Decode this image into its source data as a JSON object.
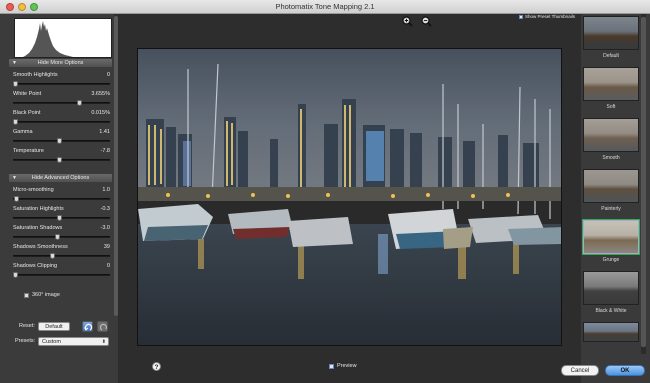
{
  "window": {
    "title": "Photomatix Tone Mapping 2.1"
  },
  "more_options": {
    "header": "Hide More Options",
    "sliders": [
      {
        "label": "Smooth Highlights",
        "value": "0",
        "level": 0.02
      },
      {
        "label": "White Point",
        "value": "3.655%",
        "level": 0.68
      },
      {
        "label": "Black Point",
        "value": "0.015%",
        "level": 0.02
      },
      {
        "label": "Gamma",
        "value": "1.41",
        "level": 0.47
      },
      {
        "label": "Temperature",
        "value": "-7.8",
        "level": 0.47
      }
    ]
  },
  "advanced_options": {
    "header": "Hide Advanced Options",
    "sliders": [
      {
        "label": "Micro-smoothing",
        "value": "1.0",
        "level": 0.03
      },
      {
        "label": "Saturation Highlights",
        "value": "-0.3",
        "level": 0.47
      },
      {
        "label": "Saturation Shadows",
        "value": "-3.0",
        "level": 0.45
      },
      {
        "label": "Shadows Smoothness",
        "value": "39",
        "level": 0.4
      },
      {
        "label": "Shadows Clipping",
        "value": "0",
        "level": 0.02
      }
    ],
    "image_360_label": "360° image"
  },
  "bottom": {
    "reset_label": "Reset:",
    "default_button": "Default",
    "presets_label": "Presets:",
    "presets_value": "Custom"
  },
  "main": {
    "preview_label": "Preview",
    "help_label": "?"
  },
  "preset_panel": {
    "show_thumbnails_label": "Show Preset Thumbnails",
    "presets": [
      "Default",
      "Soft",
      "Smooth",
      "Painterly",
      "Grunge",
      "Black & White",
      ""
    ]
  },
  "buttons": {
    "cancel": "Cancel",
    "ok": "OK"
  },
  "colors": {
    "accent": "#4a93e3",
    "panel": "#3b3b3b",
    "background": "#2a2a2a"
  }
}
